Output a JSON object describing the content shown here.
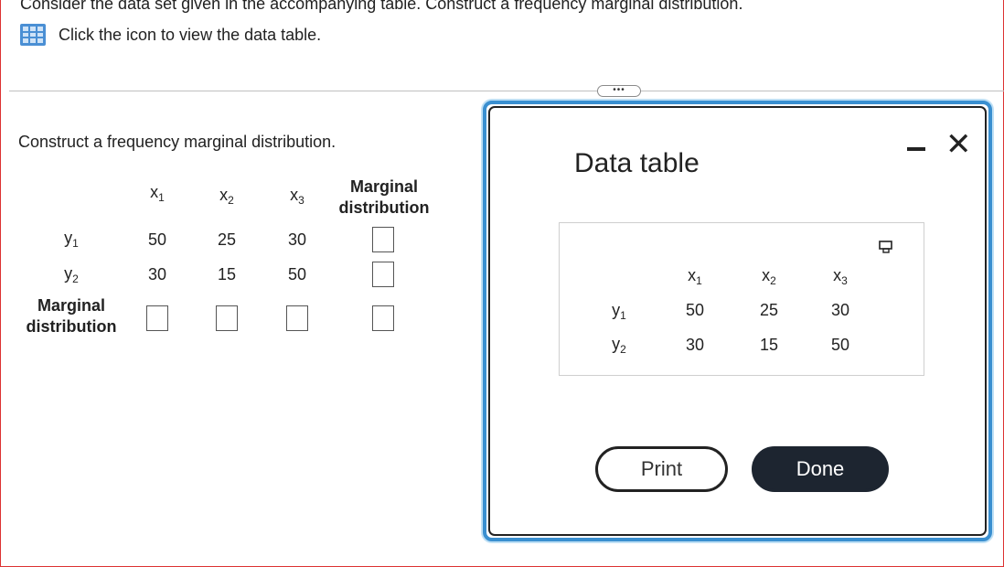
{
  "header": {
    "instruction": "Consider the data set given in the accompanying table. Construct a frequency marginal distribution.",
    "view_table_link": "Click the icon to view the data table."
  },
  "expander": "•••",
  "prompt": "Construct a frequency marginal distribution.",
  "question_table": {
    "col_headers": [
      {
        "base": "x",
        "sub": "1"
      },
      {
        "base": "x",
        "sub": "2"
      },
      {
        "base": "x",
        "sub": "3"
      }
    ],
    "marginal_header_line1": "Marginal",
    "marginal_header_line2": "distribution",
    "rows": [
      {
        "base": "y",
        "sub": "1",
        "values": [
          "50",
          "25",
          "30"
        ]
      },
      {
        "base": "y",
        "sub": "2",
        "values": [
          "30",
          "15",
          "50"
        ]
      }
    ],
    "marginal_row_label_line1": "Marginal",
    "marginal_row_label_line2": "distribution"
  },
  "modal": {
    "title": "Data table",
    "col_headers": [
      {
        "base": "x",
        "sub": "1"
      },
      {
        "base": "x",
        "sub": "2"
      },
      {
        "base": "x",
        "sub": "3"
      }
    ],
    "rows": [
      {
        "base": "y",
        "sub": "1",
        "values": [
          "50",
          "25",
          "30"
        ]
      },
      {
        "base": "y",
        "sub": "2",
        "values": [
          "30",
          "15",
          "50"
        ]
      }
    ],
    "print_label": "Print",
    "done_label": "Done"
  },
  "icons": {
    "table": "table-grid-icon",
    "copy": "copy-icon",
    "minimize": "minimize-icon",
    "close": "close-icon"
  },
  "colors": {
    "accent": "#3a8fd0",
    "done_button": "#1d2530"
  }
}
